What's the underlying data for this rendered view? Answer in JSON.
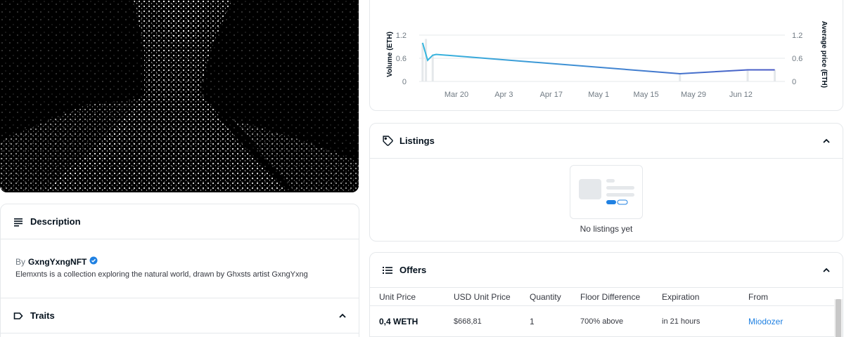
{
  "description": {
    "title": "Description",
    "by_prefix": "By",
    "creator": "GxngYxngNFT",
    "text": "Elemxnts is a collection exploring the natural world, drawn by Ghxsts artist GxngYxng"
  },
  "traits": {
    "title": "Traits"
  },
  "listings": {
    "title": "Listings",
    "empty_text": "No listings yet"
  },
  "offers": {
    "title": "Offers",
    "columns": [
      "Unit Price",
      "USD Unit Price",
      "Quantity",
      "Floor Difference",
      "Expiration",
      "From"
    ],
    "rows": [
      {
        "unit_price": "0,4 WETH",
        "usd_price": "$668,81",
        "quantity": "1",
        "floor_diff": "700% above",
        "expiration": "in 21 hours",
        "from": "Miodozer"
      }
    ]
  },
  "colors": {
    "accent": "#2081e2",
    "line_start": "#35b6de",
    "line_end": "#4a5ac6",
    "bar": "#e5e8eb",
    "border": "#e5e8eb"
  },
  "chart_data": {
    "type": "line",
    "ylabel_left": "Volume (ETH)",
    "ylabel_right": "Average price (ETH)",
    "y_ticks": [
      "0",
      "0.6",
      "1.2"
    ],
    "ylim": [
      0,
      1.4
    ],
    "x_ticks": [
      "Mar 20",
      "Apr 3",
      "Apr 17",
      "May 1",
      "May 15",
      "May 29",
      "Jun 12"
    ],
    "x_tick_days": [
      0,
      14,
      28,
      42,
      56,
      70,
      84
    ],
    "xlim_days": [
      -11,
      97
    ],
    "series": [
      {
        "kind": "line",
        "points": [
          [
            -10,
            1.0
          ],
          [
            -8.5,
            0.55
          ],
          [
            -7,
            0.68
          ],
          [
            -6,
            0.7
          ],
          [
            66,
            0.2
          ],
          [
            86,
            0.3
          ],
          [
            94,
            0.3
          ]
        ]
      }
    ],
    "bars": [
      [
        -10,
        1.0
      ],
      [
        -9,
        1.1
      ],
      [
        -7,
        0.7
      ],
      [
        66,
        0.2
      ],
      [
        86,
        0.3
      ],
      [
        94,
        0.3
      ]
    ],
    "grid": true
  }
}
